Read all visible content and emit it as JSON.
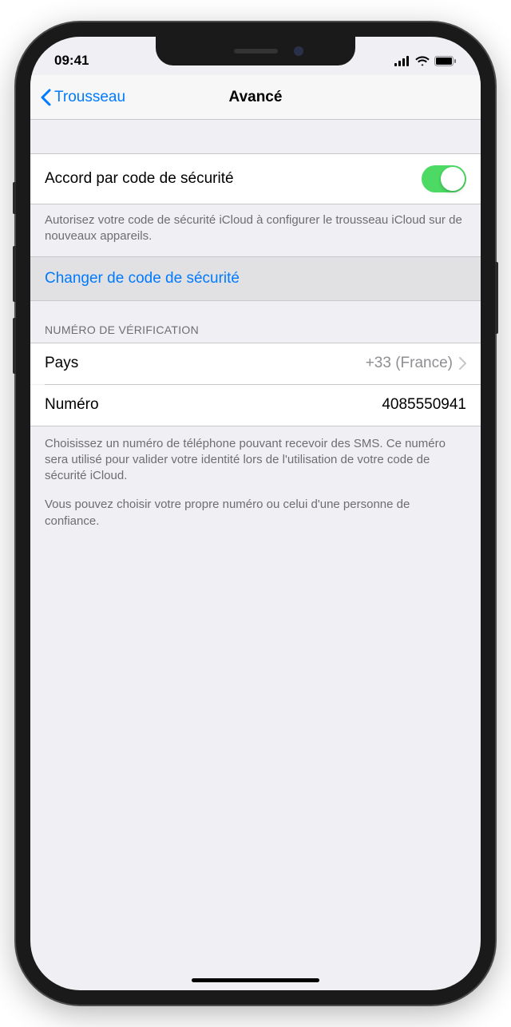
{
  "status": {
    "time": "09:41"
  },
  "nav": {
    "back_label": "Trousseau",
    "title": "Avancé"
  },
  "security_code": {
    "approve_label": "Accord par code de sécurité",
    "footer": "Autorisez votre code de sécurité iCloud à configurer le trousseau iCloud sur de nouveaux appareils.",
    "change_label": "Changer de code de sécurité"
  },
  "verification": {
    "header": "NUMÉRO DE VÉRIFICATION",
    "country_label": "Pays",
    "country_value": "+33 (France)",
    "number_label": "Numéro",
    "number_value": "4085550941",
    "footer1": "Choisissez un numéro de téléphone pouvant recevoir des SMS. Ce numéro sera utilisé pour valider votre identité lors de l'utilisation de votre code de sécurité iCloud.",
    "footer2": "Vous pouvez choisir votre propre numéro ou celui d'une personne de confiance."
  }
}
